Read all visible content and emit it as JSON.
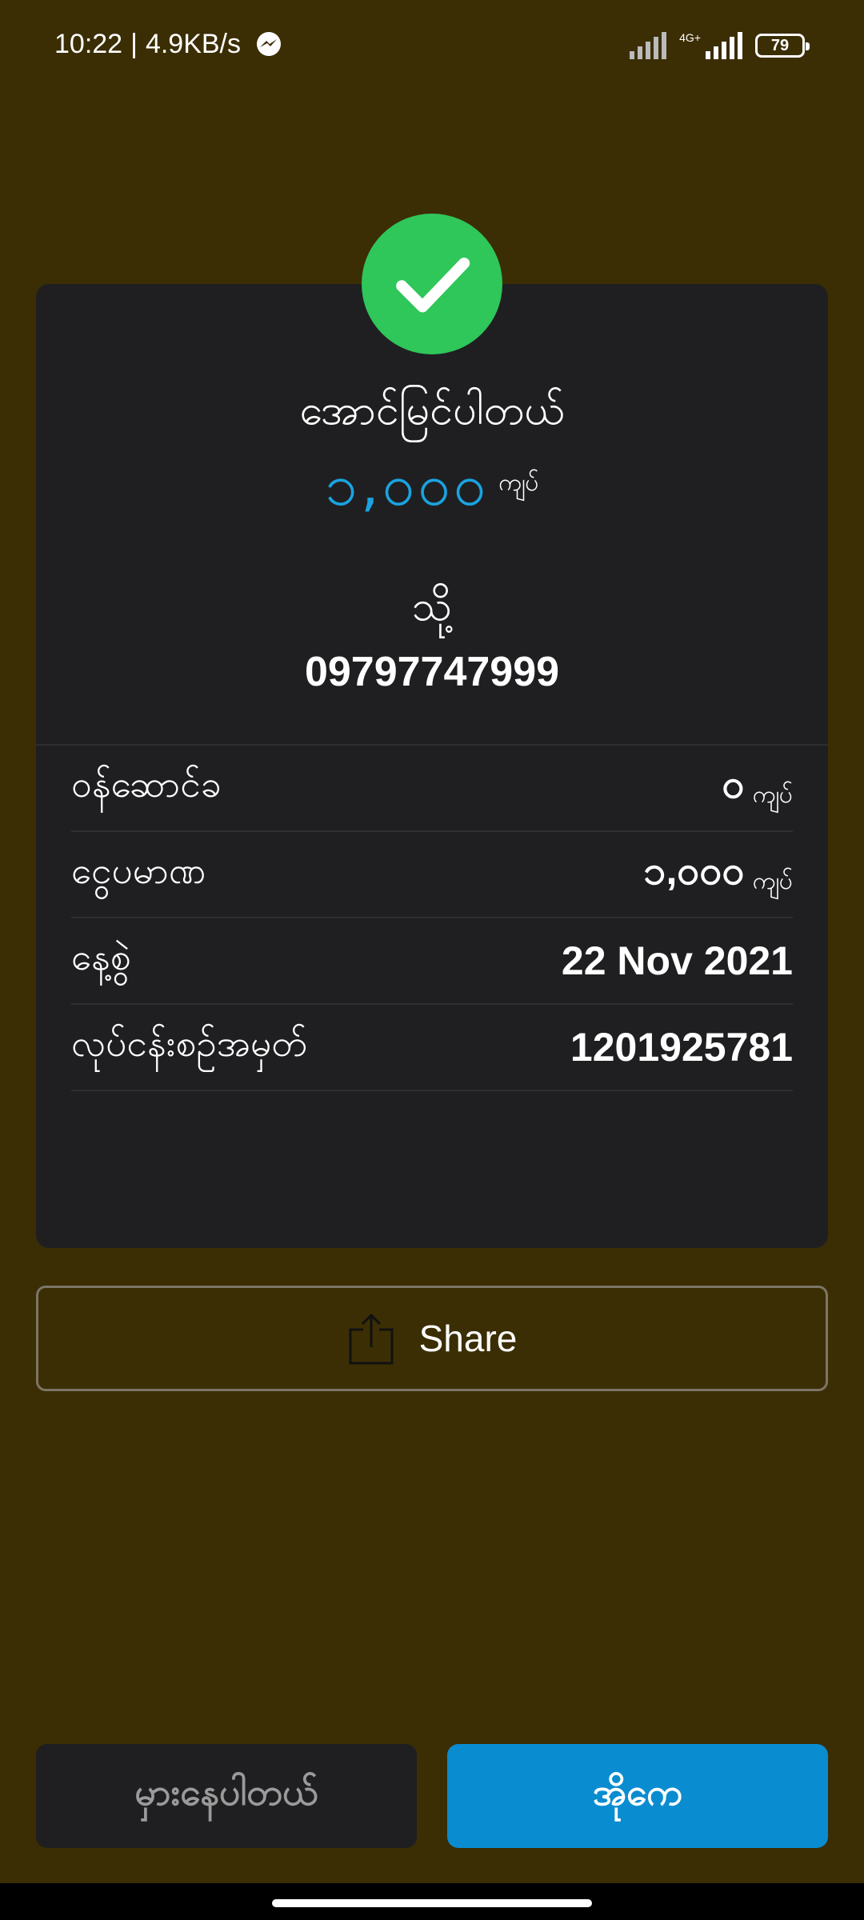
{
  "status_bar": {
    "time": "10:22",
    "separator": "|",
    "net_speed": "4.9KB/s",
    "network_type": "4G+",
    "battery": "79",
    "icons": [
      "messenger-icon",
      "signal-icon",
      "signal-4g-icon",
      "battery-icon"
    ]
  },
  "receipt": {
    "title": "အောင်မြင်ပါတယ်",
    "amount": "၁,၀၀၀",
    "amount_unit": "ကျပ်",
    "to_label": "သို့",
    "recipient": "09797747999",
    "details": [
      {
        "label": "ဝန်ဆောင်ခ",
        "value": "၀",
        "unit": "ကျပ်"
      },
      {
        "label": "ငွေပမာဏ",
        "value": "၁,၀၀၀",
        "unit": "ကျပ်"
      },
      {
        "label": "နေ့စွဲ",
        "value": "22 Nov 2021",
        "unit": ""
      },
      {
        "label": "လုပ်ငန်းစဉ်အမှတ်",
        "value": "1201925781",
        "unit": ""
      }
    ]
  },
  "actions": {
    "share_label": "Share",
    "wrong_label": "မှားနေပါတယ်",
    "ok_label": "အိုကေ"
  },
  "colors": {
    "background": "#3b2e04",
    "card": "#1f1f21",
    "success": "#2fc65a",
    "amount": "#1aa3e0",
    "primary_button": "#0a8cd0"
  }
}
